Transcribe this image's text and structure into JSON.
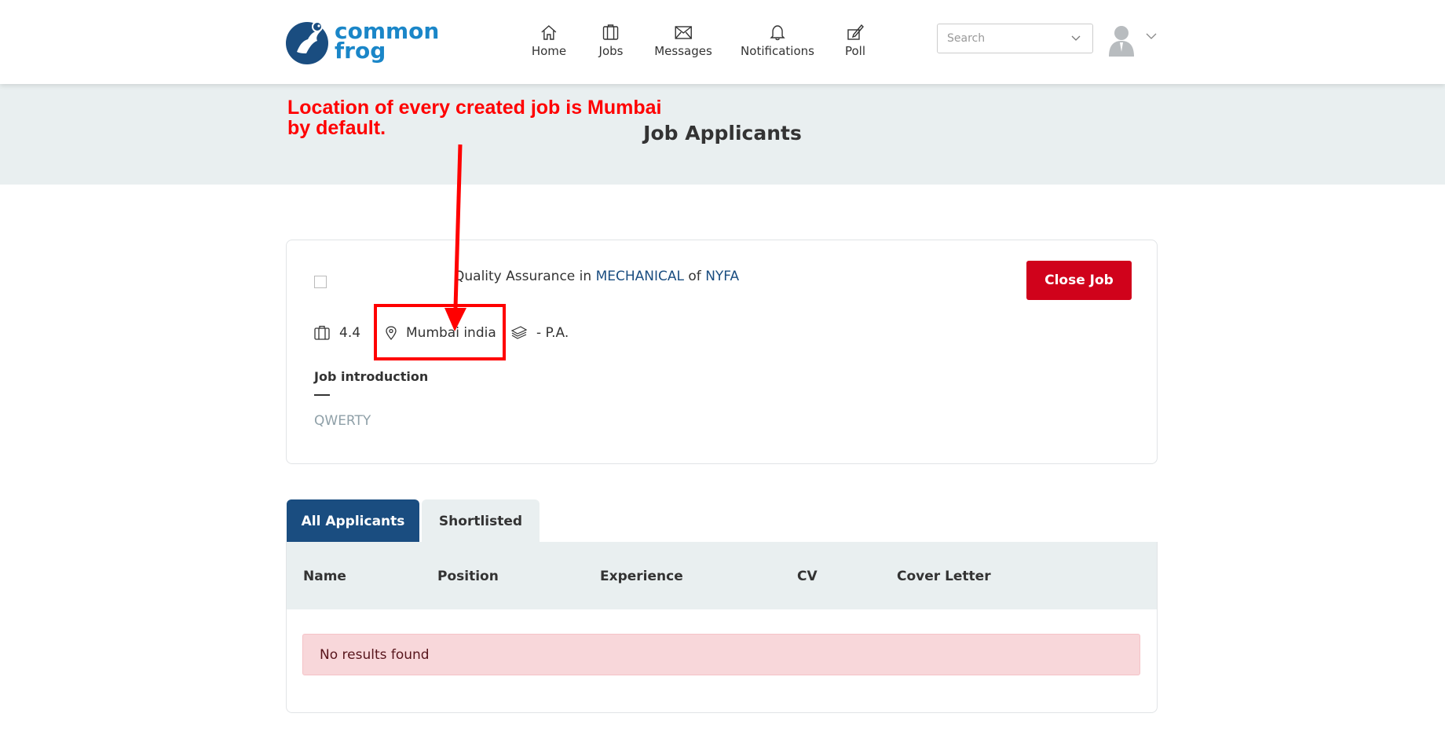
{
  "brand": {
    "line1": "common",
    "line2": "frog",
    "color": "#1a86c8"
  },
  "nav": {
    "home": "Home",
    "jobs": "Jobs",
    "messages": "Messages",
    "notifications": "Notifications",
    "poll": "Poll"
  },
  "search": {
    "placeholder": "Search"
  },
  "page": {
    "title": "Job Applicants"
  },
  "annotation": {
    "line1": "Location of every created job is Mumbai",
    "line2": "by default.",
    "color": "#ff0000"
  },
  "job": {
    "position": "Quality Assurance",
    "in_word": "in",
    "department": "MECHANICAL",
    "of_word": "of",
    "company": "NYFA",
    "close_label": "Close Job",
    "experience": "4.4",
    "location": "Mumbai india",
    "salary": "- P.A.",
    "section_title": "Job introduction",
    "intro": "QWERTY"
  },
  "tabs": {
    "all": "All Applicants",
    "shortlisted": "Shortlisted"
  },
  "table": {
    "columns": [
      "Name",
      "Position",
      "Experience",
      "CV",
      "Cover Letter"
    ],
    "empty_message": "No results found"
  },
  "colors": {
    "primary": "#1a4d80",
    "danger": "#d0021b",
    "banner": "#e9eff0"
  }
}
